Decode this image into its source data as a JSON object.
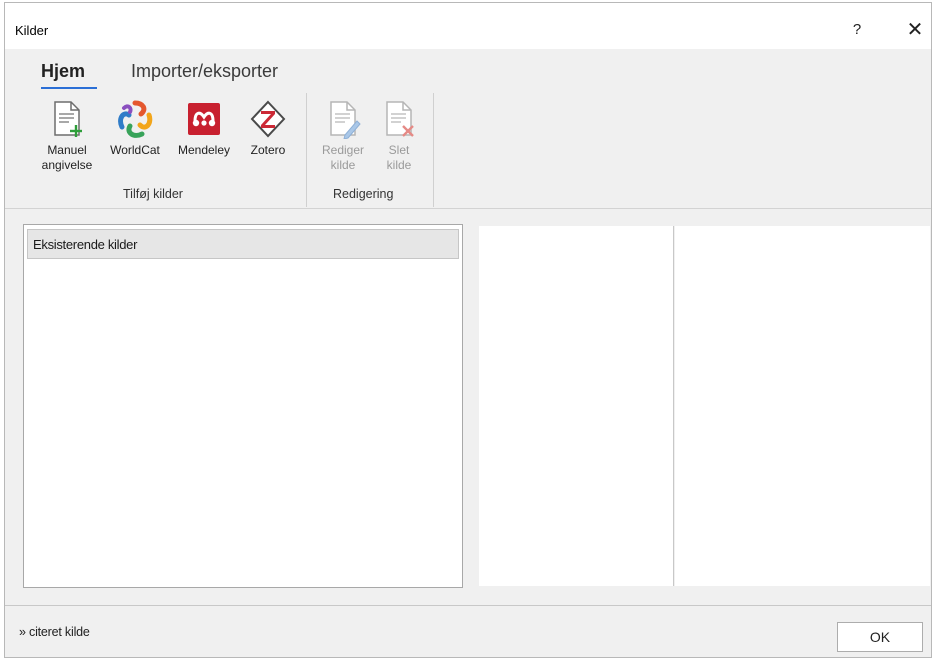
{
  "window": {
    "title": "Kilder",
    "help_symbol": "?",
    "close_symbol": "✕"
  },
  "tabs": [
    {
      "label": "Hjem",
      "active": true
    },
    {
      "label": "Importer/eksporter",
      "active": false
    }
  ],
  "ribbon": {
    "groups": [
      {
        "label": "Tilføj kilder",
        "buttons": [
          {
            "label": "Manuel\nangivelse",
            "icon": "document-add-icon",
            "enabled": true
          },
          {
            "label": "WorldCat",
            "icon": "worldcat-icon",
            "enabled": true
          },
          {
            "label": "Mendeley",
            "icon": "mendeley-icon",
            "enabled": true
          },
          {
            "label": "Zotero",
            "icon": "zotero-icon",
            "enabled": true
          }
        ]
      },
      {
        "label": "Redigering",
        "buttons": [
          {
            "label": "Rediger\nkilde",
            "icon": "edit-document-icon",
            "enabled": false
          },
          {
            "label": "Slet\nkilde",
            "icon": "delete-document-icon",
            "enabled": false
          }
        ]
      }
    ]
  },
  "sources_list": {
    "header": "Eksisterende kilder",
    "items": []
  },
  "footer": {
    "cited_link": "» citeret kilde",
    "ok_label": "OK"
  },
  "colors": {
    "accent": "#2b6fd6",
    "mendeley_red": "#c8202f",
    "zotero_red": "#cc2936",
    "add_green": "#2e9e3a",
    "delete_red": "#d9534f"
  }
}
